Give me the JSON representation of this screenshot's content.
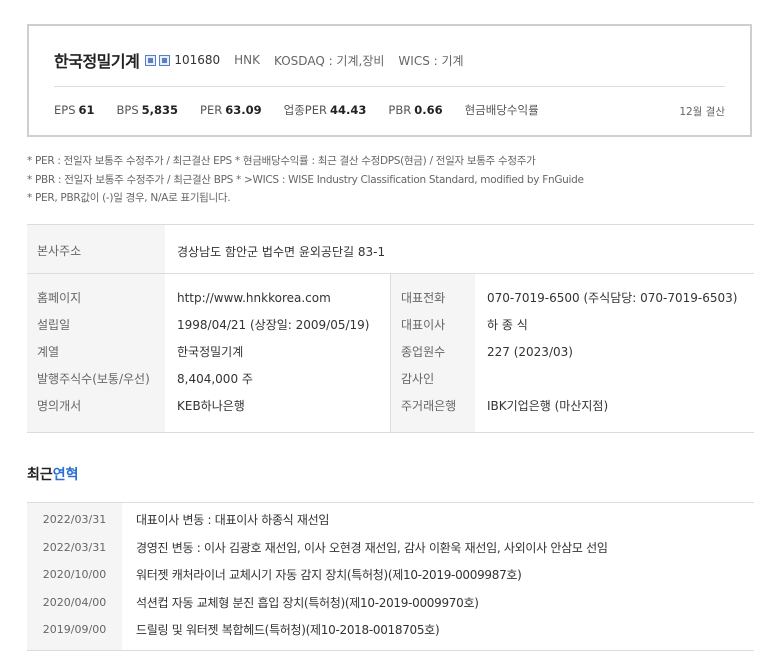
{
  "header": {
    "company_name": "한국정밀기계",
    "icons": [
      "page-icon",
      "copy-icon"
    ],
    "code": "101680",
    "english_abbr": "HNK",
    "market": "KOSDAQ : 기계,장비",
    "wics": "WICS : 기계"
  },
  "metrics": {
    "eps_label": "EPS",
    "eps_value": "61",
    "bps_label": "BPS",
    "bps_value": "5,835",
    "per_label": "PER",
    "per_value": "63.09",
    "industry_per_label": "업종PER",
    "industry_per_value": "44.43",
    "pbr_label": "PBR",
    "pbr_value": "0.66",
    "dividend_label": "현금배당수익률",
    "settlement": "12월 결산"
  },
  "notes": [
    "* PER : 전일자 보통주 수정주가 / 최근결산 EPS * 현금배당수익률 : 최근 결산 수정DPS(현금) / 전일자 보통주 수정주가",
    "* PBR : 전일자 보통주 수정주가 / 최근결산 BPS * >WICS : WISE Industry Classification Standard, modified by FnGuide",
    "* PER, PBR값이 (-)일 경우, N/A로 표기됩니다."
  ],
  "info": {
    "address_label": "본사주소",
    "address_value": "경상남도 함안군 법수면 윤외공단길 83-1",
    "left_labels": [
      "홈페이지",
      "설립일",
      "계열",
      "발행주식수(보통/우선)",
      "명의개서"
    ],
    "left_values": [
      "http://www.hnkkorea.com",
      "1998/04/21 (상장일: 2009/05/19)",
      "한국정밀기계",
      "8,404,000 주",
      "KEB하나은행"
    ],
    "right_labels": [
      "대표전화",
      "대표이사",
      "종업원수",
      "감사인",
      "주거래은행"
    ],
    "right_values": [
      "070-7019-6500 (주식담당: 070-7019-6503)",
      "하 종 식",
      "227 (2023/03)",
      "",
      "IBK기업은행 (마산지점)"
    ]
  },
  "history": {
    "title_prefix": "최근",
    "title_accent": "연혁",
    "dates": [
      "2022/03/31",
      "2022/03/31",
      "2020/10/00",
      "2020/04/00",
      "2019/09/00"
    ],
    "events": [
      "대표이사 변동 : 대표이사 하종식 재선임",
      "경영진 변동 : 이사 김광호 재선임, 이사 오현경 재선임, 감사 이환욱 재선임, 사외이사 안삼모 선임",
      "워터젯 캐처라이너 교체시기 자동 감지 장치(특허청)(제10-2019-0009987호)",
      "석션컵 자동 교체형 분진 흡입 장치(특허청)(제10-2019-0009970호)",
      "드릴링 및 워터젯 복합헤드(특허청)(제10-2018-0018705호)"
    ]
  },
  "colors": {
    "accent": "#2a6fd1",
    "border": "#cfcfcf",
    "label_bg": "#f5f5f5"
  }
}
